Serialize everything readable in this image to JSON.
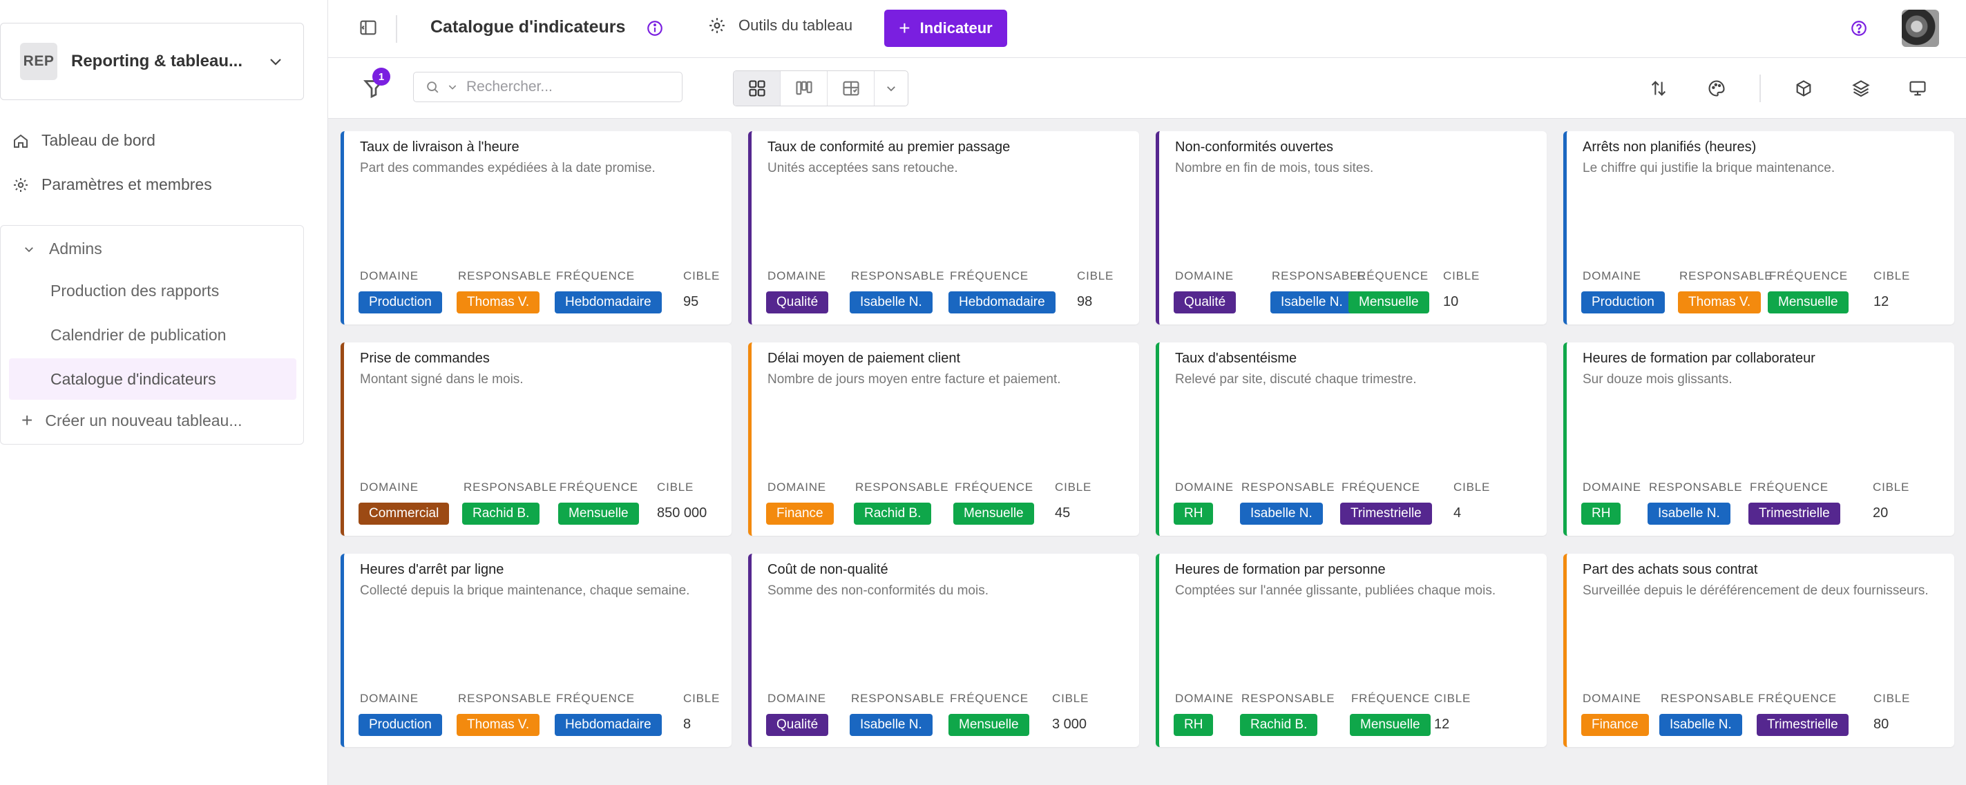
{
  "workspace": {
    "initials": "REP",
    "name": "Reporting & tableau..."
  },
  "nav": {
    "dashboard": "Tableau de bord",
    "settings": "Paramètres et membres"
  },
  "group": {
    "title": "Admins",
    "items": [
      "Production des rapports",
      "Calendrier de publication",
      "Catalogue d'indicateurs"
    ],
    "create": "Créer un nouveau tableau..."
  },
  "topbar": {
    "title": "Catalogue d'indicateurs",
    "tools": "Outils du tableau",
    "add": "Indicateur"
  },
  "toolbar": {
    "filter_count": "1",
    "search_placeholder": "Rechercher..."
  },
  "labels": {
    "domain": "DOMAINE",
    "owner": "RESPONSABLE",
    "frequency": "FRÉQUENCE",
    "target": "CIBLE"
  },
  "colors": {
    "accent": "#7a1fe0",
    "Production": "#1a67c1",
    "Qualité": "#55278f",
    "Commercial": "#9c4a14",
    "Finance": "#f38a0e",
    "RH": "#0fa74a",
    "Thomas V.": "#f38a0e",
    "Isabelle N.": "#1a67c1",
    "Rachid B.": "#0fa74a",
    "Hebdomadaire": "#1a67c1",
    "Mensuelle": "#0fa74a",
    "Trimestrielle": "#55278f"
  },
  "cards": [
    {
      "title": "Taux de livraison à l'heure",
      "desc": "Part des commandes expédiées à la date promise.",
      "domain": "Production",
      "owner": "Thomas V.",
      "frequency": "Hebdomadaire",
      "target": "95"
    },
    {
      "title": "Taux de conformité au premier passage",
      "desc": "Unités acceptées sans retouche.",
      "domain": "Qualité",
      "owner": "Isabelle N.",
      "frequency": "Hebdomadaire",
      "target": "98"
    },
    {
      "title": "Non-conformités ouvertes",
      "desc": "Nombre en fin de mois, tous sites.",
      "domain": "Qualité",
      "owner": "Isabelle N.",
      "frequency": "Mensuelle",
      "target": "10"
    },
    {
      "title": "Arrêts non planifiés (heures)",
      "desc": "Le chiffre qui justifie la brique maintenance.",
      "domain": "Production",
      "owner": "Thomas V.",
      "frequency": "Mensuelle",
      "target": "12"
    },
    {
      "title": "Prise de commandes",
      "desc": "Montant signé dans le mois.",
      "domain": "Commercial",
      "owner": "Rachid B.",
      "frequency": "Mensuelle",
      "target": "850 000"
    },
    {
      "title": "Délai moyen de paiement client",
      "desc": "Nombre de jours moyen entre facture et paiement.",
      "domain": "Finance",
      "owner": "Rachid B.",
      "frequency": "Mensuelle",
      "target": "45"
    },
    {
      "title": "Taux d'absentéisme",
      "desc": "Relevé par site, discuté chaque trimestre.",
      "domain": "RH",
      "owner": "Isabelle N.",
      "frequency": "Trimestrielle",
      "target": "4"
    },
    {
      "title": "Heures de formation par collaborateur",
      "desc": "Sur douze mois glissants.",
      "domain": "RH",
      "owner": "Isabelle N.",
      "frequency": "Trimestrielle",
      "target": "20"
    },
    {
      "title": "Heures d'arrêt par ligne",
      "desc": "Collecté depuis la brique maintenance, chaque semaine.",
      "domain": "Production",
      "owner": "Thomas V.",
      "frequency": "Hebdomadaire",
      "target": "8"
    },
    {
      "title": "Coût de non-qualité",
      "desc": "Somme des non-conformités du mois.",
      "domain": "Qualité",
      "owner": "Isabelle N.",
      "frequency": "Mensuelle",
      "target": "3 000"
    },
    {
      "title": "Heures de formation par personne",
      "desc": "Comptées sur l'année glissante, publiées chaque mois.",
      "domain": "RH",
      "owner": "Rachid B.",
      "frequency": "Mensuelle",
      "target": "12"
    },
    {
      "title": "Part des achats sous contrat",
      "desc": "Surveillée depuis le déréférencement de deux fournisseurs.",
      "domain": "Finance",
      "owner": "Isabelle N.",
      "frequency": "Trimestrielle",
      "target": "80"
    }
  ]
}
